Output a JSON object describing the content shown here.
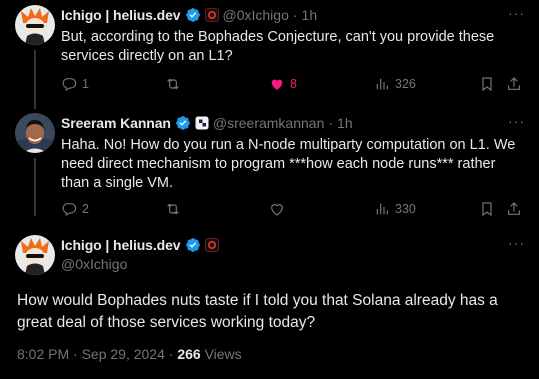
{
  "tweets": [
    {
      "name": "Ichigo | helius.dev",
      "handle": "@0xIchigo",
      "dot": "·",
      "time": "1h",
      "text": "But, according to the Bophades Conjecture, can't you provide these services directly on an L1?",
      "replies": "1",
      "retweets": "",
      "likes": "8",
      "views": "326",
      "liked": true
    },
    {
      "name": "Sreeram Kannan",
      "handle": "@sreeramkannan",
      "dot": "·",
      "time": "1h",
      "text": "Haha. No! How do you run a N-node multiparty computation on L1. We need direct mechanism to program ***how each node runs*** rather than a single VM.",
      "replies": "2",
      "retweets": "",
      "likes": "",
      "views": "330",
      "liked": false
    }
  ],
  "main": {
    "name": "Ichigo | helius.dev",
    "handle": "@0xIchigo",
    "text": "How would Bophades nuts taste if I told you that Solana already has a great deal of those services working today?",
    "timestamp": "8:02 PM · Sep 29, 2024 · ",
    "views_count": "266",
    "views_label": "Views"
  },
  "colors": {
    "background": "#000000",
    "verified": "#1d9bf0",
    "like_active": "#f91880",
    "muted": "#71767b",
    "text": "#e7e9ea",
    "affiliate_red": "#e03a2f"
  }
}
